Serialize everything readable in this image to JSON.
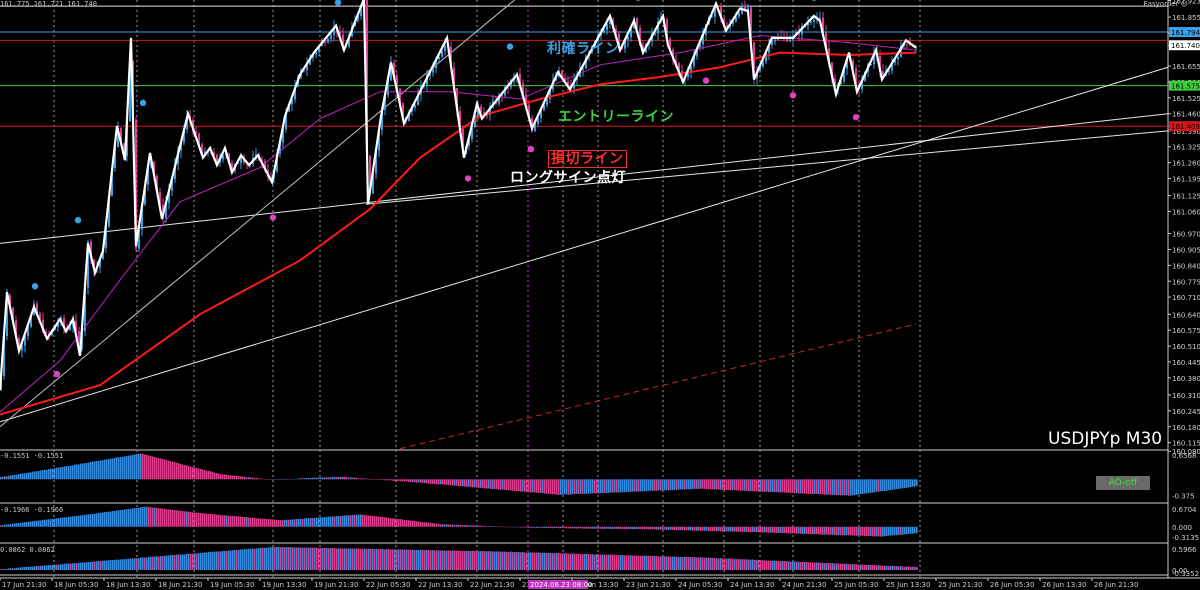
{
  "header": {
    "top_left": "161.775 161.721 161.740",
    "top_right": "Easyorder ☺"
  },
  "symbol": "USDJPYp M30",
  "labels": {
    "take_profit": "利確ライン",
    "entry": "エントリーライン",
    "stop_loss": "損切ライン",
    "long_signal": "ロングサイン点灯"
  },
  "ao_button": "AO-off",
  "colors": {
    "background": "#000000",
    "candle_up": "#3aa0e6",
    "candle_down": "#e0409a",
    "zigzag": "#ffffff",
    "ma_red": "#ff1a1a",
    "ma_magenta": "#c020c0",
    "tp_line": "#3aa0e6",
    "entry_line": "#3ecf3e",
    "sl_line": "#d01818",
    "hist_up": "#3a8ee0",
    "hist_down": "#e0408e",
    "grid": "#9a9a9a"
  },
  "chart_data": [
    {
      "type": "candlestick",
      "ylim": [
        160.085,
        161.925
      ],
      "y_ticks": [
        "161.923",
        "161.855",
        "161.790",
        "161.740",
        "161.655",
        "161.590",
        "161.525",
        "161.460",
        "161.390",
        "161.325",
        "161.260",
        "161.195",
        "161.125",
        "161.060",
        "160.970",
        "160.905",
        "160.840",
        "160.775",
        "160.710",
        "160.640",
        "160.575",
        "160.510",
        "160.445",
        "160.380",
        "160.310",
        "160.245",
        "160.180",
        "160.115",
        "160.080"
      ],
      "price_tags": [
        {
          "value": "161.794",
          "price": 161.794,
          "color": "#3aa0e6"
        },
        {
          "value": "161.740",
          "price": 161.74,
          "color": "#ffffff"
        },
        {
          "value": "161.575",
          "price": 161.575,
          "color": "#3ecf3e"
        },
        {
          "value": "161.409",
          "price": 161.409,
          "color": "#d01818"
        }
      ],
      "h_lines": [
        {
          "name": "take-profit-line",
          "price": 161.794,
          "color": "#3aa0e6"
        },
        {
          "name": "entry-line",
          "price": 161.575,
          "color": "#3ecf3e"
        },
        {
          "name": "stop-loss-line",
          "price": 161.409,
          "color": "#d01818"
        },
        {
          "name": "resistance-line",
          "price": 161.76,
          "color": "#d01818"
        },
        {
          "name": "top-line",
          "price": 161.9,
          "color": "#e0e0e0"
        }
      ],
      "zigzag": [
        {
          "x": 0,
          "y": 160.33
        },
        {
          "x": 7,
          "y": 160.73
        },
        {
          "x": 19,
          "y": 160.49
        },
        {
          "x": 34,
          "y": 160.67
        },
        {
          "x": 47,
          "y": 160.54
        },
        {
          "x": 60,
          "y": 160.62
        },
        {
          "x": 66,
          "y": 160.57
        },
        {
          "x": 73,
          "y": 160.62
        },
        {
          "x": 80,
          "y": 160.47
        },
        {
          "x": 88,
          "y": 160.93
        },
        {
          "x": 95,
          "y": 160.81
        },
        {
          "x": 103,
          "y": 160.9
        },
        {
          "x": 117,
          "y": 161.41
        },
        {
          "x": 125,
          "y": 161.27
        },
        {
          "x": 131,
          "y": 161.77
        },
        {
          "x": 136,
          "y": 160.92
        },
        {
          "x": 150,
          "y": 161.3
        },
        {
          "x": 162,
          "y": 161.03
        },
        {
          "x": 188,
          "y": 161.46
        },
        {
          "x": 203,
          "y": 161.28
        },
        {
          "x": 210,
          "y": 161.32
        },
        {
          "x": 217,
          "y": 161.25
        },
        {
          "x": 225,
          "y": 161.32
        },
        {
          "x": 232,
          "y": 161.22
        },
        {
          "x": 241,
          "y": 161.29
        },
        {
          "x": 249,
          "y": 161.25
        },
        {
          "x": 258,
          "y": 161.29
        },
        {
          "x": 272,
          "y": 161.18
        },
        {
          "x": 285,
          "y": 161.45
        },
        {
          "x": 300,
          "y": 161.62
        },
        {
          "x": 314,
          "y": 161.71
        },
        {
          "x": 336,
          "y": 161.82
        },
        {
          "x": 344,
          "y": 161.72
        },
        {
          "x": 364,
          "y": 161.93
        },
        {
          "x": 368,
          "y": 161.09
        },
        {
          "x": 381,
          "y": 161.45
        },
        {
          "x": 391,
          "y": 161.67
        },
        {
          "x": 404,
          "y": 161.42
        },
        {
          "x": 447,
          "y": 161.77
        },
        {
          "x": 464,
          "y": 161.28
        },
        {
          "x": 477,
          "y": 161.5
        },
        {
          "x": 482,
          "y": 161.44
        },
        {
          "x": 517,
          "y": 161.62
        },
        {
          "x": 532,
          "y": 161.4
        },
        {
          "x": 558,
          "y": 161.63
        },
        {
          "x": 570,
          "y": 161.56
        },
        {
          "x": 610,
          "y": 161.86
        },
        {
          "x": 620,
          "y": 161.72
        },
        {
          "x": 634,
          "y": 161.84
        },
        {
          "x": 643,
          "y": 161.71
        },
        {
          "x": 663,
          "y": 161.86
        },
        {
          "x": 668,
          "y": 161.74
        },
        {
          "x": 683,
          "y": 161.59
        },
        {
          "x": 716,
          "y": 161.91
        },
        {
          "x": 726,
          "y": 161.8
        },
        {
          "x": 740,
          "y": 161.89
        },
        {
          "x": 748,
          "y": 161.88
        },
        {
          "x": 754,
          "y": 161.6
        },
        {
          "x": 772,
          "y": 161.77
        },
        {
          "x": 793,
          "y": 161.77
        },
        {
          "x": 814,
          "y": 161.86
        },
        {
          "x": 820,
          "y": 161.84
        },
        {
          "x": 836,
          "y": 161.54
        },
        {
          "x": 849,
          "y": 161.71
        },
        {
          "x": 857,
          "y": 161.55
        },
        {
          "x": 876,
          "y": 161.72
        },
        {
          "x": 882,
          "y": 161.6
        },
        {
          "x": 906,
          "y": 161.76
        },
        {
          "x": 916,
          "y": 161.73
        }
      ],
      "ma_red": [
        {
          "x": 0,
          "y": 160.23
        },
        {
          "x": 100,
          "y": 160.35
        },
        {
          "x": 200,
          "y": 160.64
        },
        {
          "x": 300,
          "y": 160.86
        },
        {
          "x": 370,
          "y": 161.07
        },
        {
          "x": 420,
          "y": 161.28
        },
        {
          "x": 480,
          "y": 161.45
        },
        {
          "x": 540,
          "y": 161.52
        },
        {
          "x": 600,
          "y": 161.58
        },
        {
          "x": 660,
          "y": 161.61
        },
        {
          "x": 720,
          "y": 161.65
        },
        {
          "x": 780,
          "y": 161.71
        },
        {
          "x": 850,
          "y": 161.7
        },
        {
          "x": 916,
          "y": 161.71
        }
      ],
      "ma_magenta": [
        {
          "x": 0,
          "y": 160.24
        },
        {
          "x": 60,
          "y": 160.45
        },
        {
          "x": 120,
          "y": 160.78
        },
        {
          "x": 180,
          "y": 161.1
        },
        {
          "x": 260,
          "y": 161.24
        },
        {
          "x": 320,
          "y": 161.44
        },
        {
          "x": 380,
          "y": 161.55
        },
        {
          "x": 450,
          "y": 161.55
        },
        {
          "x": 520,
          "y": 161.52
        },
        {
          "x": 600,
          "y": 161.66
        },
        {
          "x": 680,
          "y": 161.71
        },
        {
          "x": 760,
          "y": 161.78
        },
        {
          "x": 850,
          "y": 161.75
        },
        {
          "x": 916,
          "y": 161.72
        }
      ],
      "trendlines": [
        {
          "name": "trendline-1",
          "x1": 0,
          "y1": 160.93,
          "x2": 1168,
          "y2": 161.46,
          "color": "#e8e8e8",
          "dash": false
        },
        {
          "name": "trendline-2",
          "x1": 0,
          "y1": 160.2,
          "x2": 1168,
          "y2": 161.65,
          "color": "#e8e8e8",
          "dash": false
        },
        {
          "name": "trendline-3",
          "x1": 0,
          "y1": 160.18,
          "x2": 516,
          "y2": 161.93,
          "color": "#c0c0c0",
          "dash": false
        },
        {
          "name": "trendline-4",
          "x1": 366,
          "y1": 161.09,
          "x2": 1168,
          "y2": 161.39,
          "color": "#e8e8e8",
          "dash": false
        },
        {
          "name": "trendline-dashed",
          "x1": 400,
          "y1": 160.09,
          "x2": 916,
          "y2": 160.6,
          "color": "#c02828",
          "dash": true
        }
      ],
      "arrows_up": [
        {
          "x": 78,
          "y": 161.0
        },
        {
          "x": 143,
          "y": 161.48
        },
        {
          "x": 338,
          "y": 161.89
        },
        {
          "x": 510,
          "y": 161.71
        },
        {
          "x": 638,
          "y": 161.91
        },
        {
          "x": 748,
          "y": 161.92
        },
        {
          "x": 814,
          "y": 161.91
        },
        {
          "x": 35,
          "y": 160.73
        }
      ],
      "arrows_down": [
        {
          "x": 57,
          "y": 160.42
        },
        {
          "x": 273,
          "y": 161.06
        },
        {
          "x": 468,
          "y": 161.22
        },
        {
          "x": 531,
          "y": 161.34
        },
        {
          "x": 706,
          "y": 161.62
        },
        {
          "x": 793,
          "y": 161.56
        },
        {
          "x": 856,
          "y": 161.47
        }
      ],
      "candles_seed": 7
    },
    {
      "type": "bar",
      "title": "-0.1551 -0.1551",
      "ylim": [
        -0.55,
        0.6568
      ],
      "y_ticks": [
        "0.6568",
        "-0.375"
      ],
      "x_range": [
        0,
        916
      ],
      "segments": [
        {
          "from": 0,
          "to": 60,
          "v0": 0.05,
          "v1": 0.28
        },
        {
          "from": 60,
          "to": 140,
          "v0": 0.28,
          "v1": 0.6
        },
        {
          "from": 140,
          "to": 220,
          "v0": 0.6,
          "v1": 0.12
        },
        {
          "from": 220,
          "to": 270,
          "v0": 0.12,
          "v1": -0.01
        },
        {
          "from": 270,
          "to": 340,
          "v0": -0.01,
          "v1": 0.06
        },
        {
          "from": 340,
          "to": 420,
          "v0": 0.06,
          "v1": -0.08
        },
        {
          "from": 420,
          "to": 560,
          "v0": -0.08,
          "v1": -0.36
        },
        {
          "from": 560,
          "to": 700,
          "v0": -0.36,
          "v1": -0.22
        },
        {
          "from": 700,
          "to": 850,
          "v0": -0.22,
          "v1": -0.38
        },
        {
          "from": 850,
          "to": 916,
          "v0": -0.38,
          "v1": -0.16
        }
      ]
    },
    {
      "type": "bar",
      "title": "-0.1966 -0.1966",
      "ylim": [
        -0.5,
        0.6704
      ],
      "y_ticks": [
        "0.6704",
        "0.000",
        "-0.3135"
      ],
      "x_range": [
        0,
        916
      ],
      "segments": [
        {
          "from": 0,
          "to": 80,
          "v0": 0.05,
          "v1": 0.35
        },
        {
          "from": 80,
          "to": 145,
          "v0": 0.35,
          "v1": 0.62
        },
        {
          "from": 145,
          "to": 200,
          "v0": 0.62,
          "v1": 0.42
        },
        {
          "from": 200,
          "to": 280,
          "v0": 0.42,
          "v1": 0.2
        },
        {
          "from": 280,
          "to": 360,
          "v0": 0.2,
          "v1": 0.38
        },
        {
          "from": 360,
          "to": 440,
          "v0": 0.38,
          "v1": 0.08
        },
        {
          "from": 440,
          "to": 530,
          "v0": 0.08,
          "v1": -0.03
        },
        {
          "from": 530,
          "to": 650,
          "v0": -0.03,
          "v1": -0.08
        },
        {
          "from": 650,
          "to": 760,
          "v0": -0.08,
          "v1": -0.17
        },
        {
          "from": 760,
          "to": 880,
          "v0": -0.17,
          "v1": -0.3
        },
        {
          "from": 880,
          "to": 916,
          "v0": -0.3,
          "v1": -0.2
        }
      ]
    },
    {
      "type": "bar",
      "title": "0.0862 0.0862",
      "ylim": [
        -0.12,
        0.5966
      ],
      "y_ticks": [
        "0.5966",
        "0.00",
        "-0.3352"
      ],
      "x_range": [
        0,
        916
      ],
      "segments": [
        {
          "from": 0,
          "to": 272,
          "v0": 0.02,
          "v1": 0.55
        },
        {
          "from": 272,
          "to": 500,
          "v0": 0.55,
          "v1": 0.44
        },
        {
          "from": 500,
          "to": 700,
          "v0": 0.44,
          "v1": 0.3
        },
        {
          "from": 700,
          "to": 916,
          "v0": 0.3,
          "v1": 0.07
        }
      ]
    }
  ],
  "x_ticks": [
    {
      "x": 0,
      "label": "17 Jun 21:30"
    },
    {
      "x": 52,
      "label": "18 Jun 05:30"
    },
    {
      "x": 104,
      "label": "18 Jun 13:30"
    },
    {
      "x": 156,
      "label": "18 Jun 21:30"
    },
    {
      "x": 208,
      "label": "19 Jun 05:30"
    },
    {
      "x": 260,
      "label": "19 Jun 13:30"
    },
    {
      "x": 312,
      "label": "19 Jun 21:30"
    },
    {
      "x": 364,
      "label": "22 Jun 05:30"
    },
    {
      "x": 416,
      "label": "22 Jun 13:30"
    },
    {
      "x": 468,
      "label": "22 Jun 21:30"
    },
    {
      "x": 520,
      "label": "23 Jun 05:30"
    },
    {
      "x": 572,
      "label": "23 Jun 13:30"
    },
    {
      "x": 624,
      "label": "23 Jun 21:30"
    },
    {
      "x": 676,
      "label": "24 Jun 05:30"
    },
    {
      "x": 728,
      "label": "24 Jun 13:30"
    },
    {
      "x": 780,
      "label": "24 Jun 21:30"
    },
    {
      "x": 832,
      "label": "25 Jun 05:30"
    },
    {
      "x": 884,
      "label": "25 Jun 13:30"
    },
    {
      "x": 936,
      "label": "25 Jun 21:30"
    },
    {
      "x": 988,
      "label": "26 Jun 05:30"
    },
    {
      "x": 1040,
      "label": "26 Jun 13:30"
    },
    {
      "x": 1092,
      "label": "26 Jun 21:30"
    }
  ],
  "x_highlight": {
    "label": "2024.06.23 08:00"
  },
  "v_grid": [
    54,
    137,
    194,
    273,
    320,
    396,
    477,
    528,
    563,
    598,
    663,
    724,
    760,
    793,
    859,
    920
  ],
  "v_magenta": 528
}
